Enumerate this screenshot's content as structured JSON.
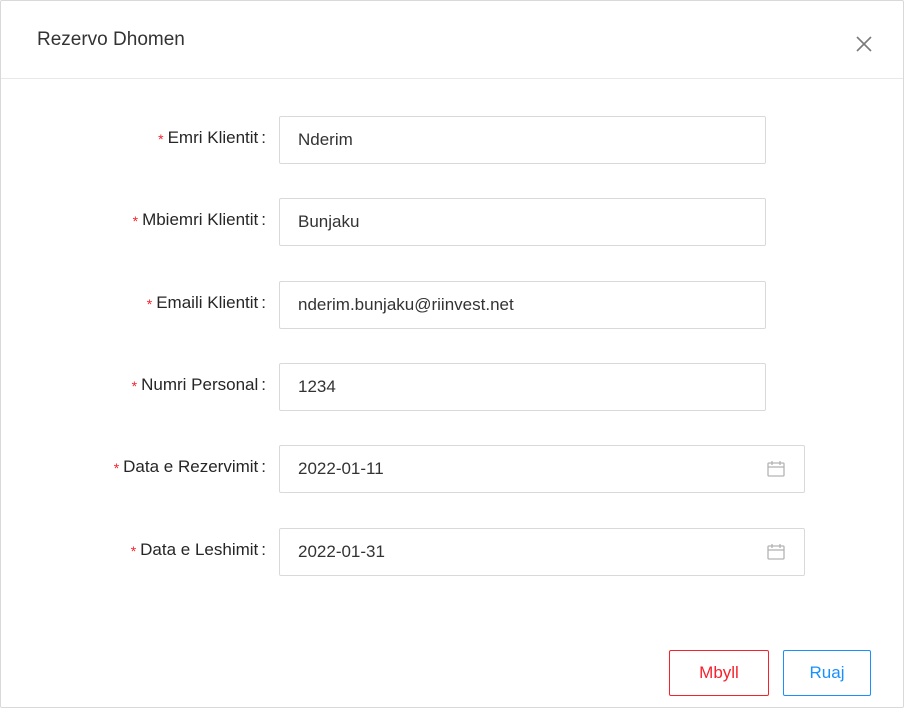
{
  "modal": {
    "title": "Rezervo Dhomen",
    "close_icon": "close-icon"
  },
  "form": {
    "fields": [
      {
        "label": "Emri Klientit",
        "required": true,
        "value": "Nderim",
        "type": "text"
      },
      {
        "label": "Mbiemri Klientit",
        "required": true,
        "value": "Bunjaku",
        "type": "text"
      },
      {
        "label": "Emaili Klientit",
        "required": true,
        "value": "nderim.bunjaku@riinvest.net",
        "type": "text"
      },
      {
        "label": "Numri Personal",
        "required": true,
        "value": "1234",
        "type": "text"
      },
      {
        "label": "Data e Rezervimit",
        "required": true,
        "value": "2022-01-11",
        "type": "date",
        "icon": "calendar-icon"
      },
      {
        "label": "Data e Leshimit",
        "required": true,
        "value": "2022-01-31",
        "type": "date",
        "icon": "calendar-icon"
      }
    ],
    "colon": ":",
    "required_mark": "*"
  },
  "footer": {
    "close_label": "Mbyll",
    "save_label": "Ruaj"
  },
  "colors": {
    "required": "#f5222d",
    "danger": "#f5222d",
    "primary": "#1890ff",
    "border": "#d9d9d9"
  }
}
